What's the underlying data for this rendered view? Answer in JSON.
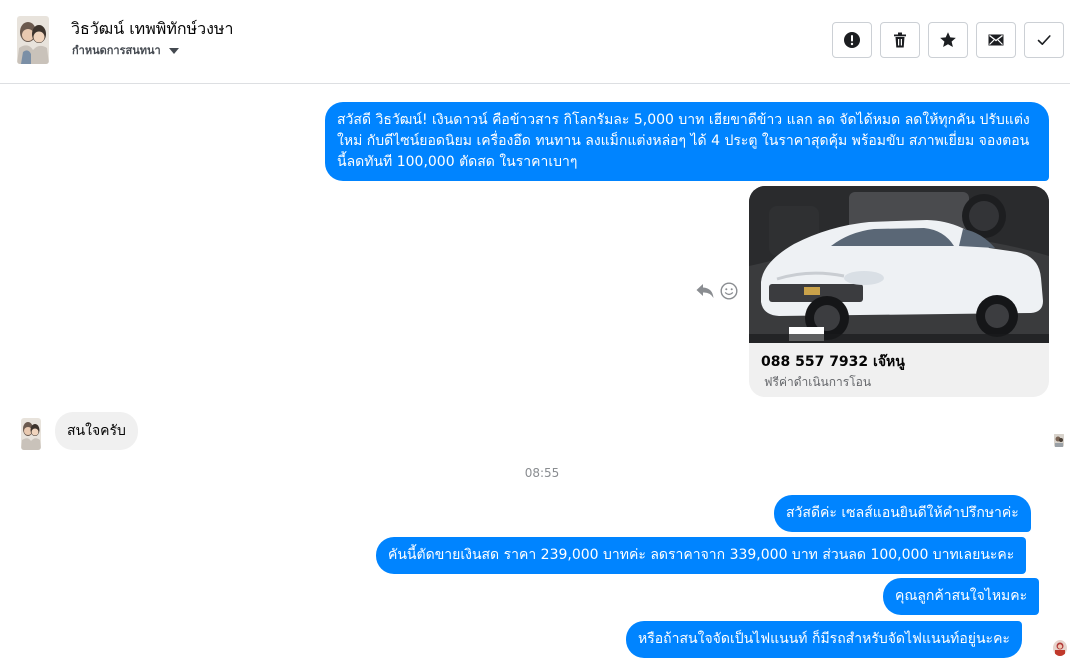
{
  "header": {
    "contact_name": "วิธวัฒน์ เทพพิทักษ์วงษา",
    "label_selector": "กำหนดการสนทนา",
    "actions": [
      {
        "name": "mark-spam",
        "icon": "alert-icon"
      },
      {
        "name": "delete",
        "icon": "trash-icon"
      },
      {
        "name": "star",
        "icon": "star-icon"
      },
      {
        "name": "mark-unread",
        "icon": "envelope-icon"
      },
      {
        "name": "mark-done",
        "icon": "check-icon"
      }
    ]
  },
  "conversation": {
    "messages": [
      {
        "from": "page",
        "text": "สวัสดี วิธวัฒน์! เงินดาวน์ คือข้าวสาร กิโลกรัมละ 5,000 บาท เฮียขาดีข้าว แลก ลด จัดได้หมด ลดให้ทุกคัน ปรับแต่งใหม่ กับดีไซน์ยอดนิยม เครื่องอึด ทนทาน ลงแม็กแต่งหล่อๆ ได้ 4 ประตู ในราคาสุดคุ้ม พร้อมขับ สภาพเยี่ยม จองตอนนี้ลดทันที 100,000 ตัดสด ในราคาเบาๆ"
      },
      {
        "from": "page",
        "type": "card",
        "title": "088 557 7932 เจ๊หนู",
        "subtitle": "ฟรีค่าดำเนินการโอน"
      },
      {
        "from": "customer",
        "text": "สนใจครับ"
      },
      {
        "from": "page",
        "text": "สวัสดีค่ะ เซลส์แอนยินดีให้คำปรึกษาค่ะ"
      },
      {
        "from": "page",
        "text": "คันนี้ตัดขายเงินสด ราคา 239,000 บาทค่ะ ลดราคาจาก 339,000 บาท ส่วนลด 100,000 บาทเลยนะคะ"
      },
      {
        "from": "page",
        "text": "คุณลูกค้าสนใจไหมคะ"
      },
      {
        "from": "page",
        "text": "หรือถ้าสนใจจัดเป็นไฟแนนท์ ก็มีรถสำหรับจัดไฟแนนท์อยู่นะคะ"
      }
    ],
    "timestamp": "08:55"
  },
  "colors": {
    "outgoing_bubble": "#0084ff",
    "incoming_bubble": "#f0f0f0",
    "divider": "#dddfe2",
    "timestamp": "#8a8d91"
  }
}
